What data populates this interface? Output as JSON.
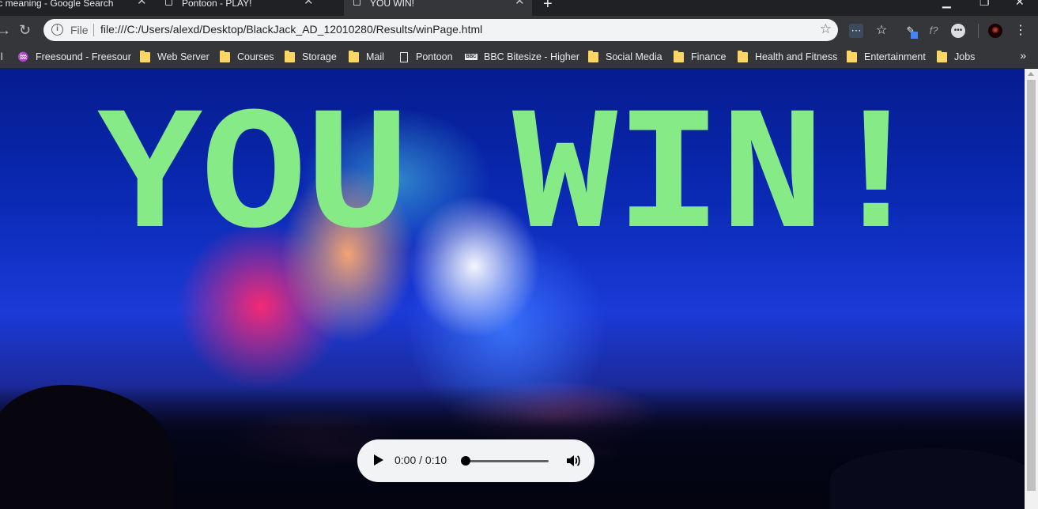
{
  "tabs": [
    {
      "title": "/c meaning - Google Search",
      "active": false
    },
    {
      "title": "Pontoon - PLAY!",
      "active": false
    },
    {
      "title": "YOU WIN!",
      "active": true
    }
  ],
  "omnibox": {
    "security_label": "File",
    "url": "file:///C:/Users/alexd/Desktop/BlackJack_AD_12010280/Results/winPage.html"
  },
  "bookmarks": [
    {
      "label": "Freesound - Freesour",
      "icon": "freesound-icon"
    },
    {
      "label": "Web Server",
      "icon": "folder-icon"
    },
    {
      "label": "Courses",
      "icon": "folder-icon"
    },
    {
      "label": "Storage",
      "icon": "folder-icon"
    },
    {
      "label": "Mail",
      "icon": "folder-icon"
    },
    {
      "label": "Pontoon",
      "icon": "page-icon"
    },
    {
      "label": "BBC Bitesize - Higher",
      "icon": "bbc-icon"
    },
    {
      "label": "Social Media",
      "icon": "folder-icon"
    },
    {
      "label": "Finance",
      "icon": "folder-icon"
    },
    {
      "label": "Health and Fitness",
      "icon": "folder-icon"
    },
    {
      "label": "Entertainment",
      "icon": "folder-icon"
    },
    {
      "label": "Jobs",
      "icon": "folder-icon"
    }
  ],
  "page": {
    "heading": "YOU WIN!"
  },
  "audio": {
    "time": "0:00 / 0:10",
    "progress": 0
  },
  "colors": {
    "heading": "#86ea86",
    "chrome_dark": "#202124",
    "toolbar": "#35363a"
  }
}
